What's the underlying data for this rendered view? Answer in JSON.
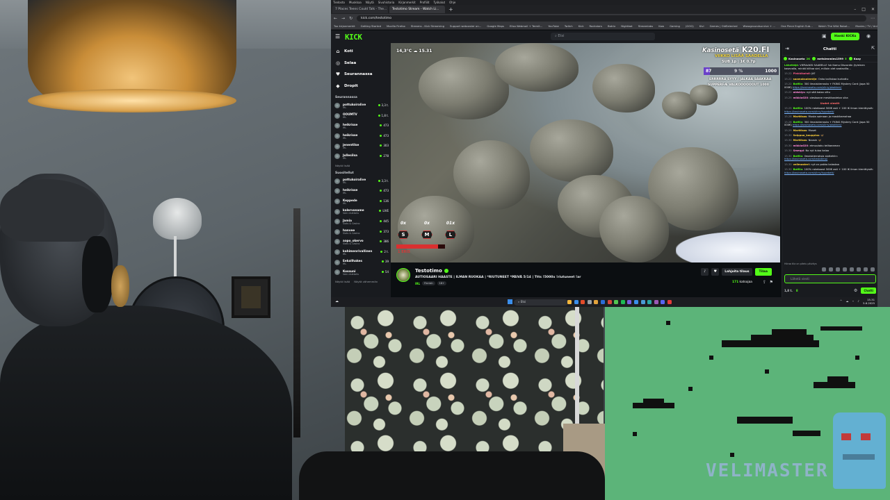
{
  "browser": {
    "menu_items": [
      "Tiedosto",
      "Muokkaa",
      "Näytä",
      "Sivuhistoria",
      "Kirjanmerkit",
      "Profiilit",
      "Työkalut",
      "Ohje"
    ],
    "tabs": [
      "7 Places Teens Could Talk - The...",
      "Testotimo Stream - Watch Li..."
    ],
    "url": "kick.com/testotimo",
    "bookmarks": [
      "Tuo kirjanmerkit",
      "Getting Started",
      "Mozilla Firefox",
      "Streams - Kick Streaming",
      "Support webcaster on...",
      "Google Maps",
      "Elisa Webmail + Termit...",
      "YouTube",
      "Twitch",
      "Kick",
      "Rockstars",
      "Botrix",
      "Nightbot",
      "Streamlabs",
      "Kaw",
      "Gaming",
      "(GOG)",
      "Kivi",
      "Games | OldSelected",
      "Wwwgroundsurvive + ...",
      "One Piece English Sub...",
      "Watch The Wild Robot...",
      "Movies / TV / Anime...",
      "Muut kirjanmerkit"
    ]
  },
  "kick": {
    "logo": "KICK",
    "search_placeholder": "Etsi",
    "login_label": "Hanki KICKs",
    "nav": [
      {
        "icon": "home-icon",
        "label": "Koti"
      },
      {
        "icon": "browse-icon",
        "label": "Selaa"
      },
      {
        "icon": "following-icon",
        "label": "Seurannassa"
      },
      {
        "icon": "drops-icon",
        "label": "Dropit"
      }
    ],
    "following_title": "Seurannassa",
    "following": [
      {
        "name": "pottukoiralive",
        "category": "IRL",
        "viewers": "3,3 t."
      },
      {
        "name": "OOUMTV",
        "category": "IRL",
        "viewers": "1,8 t."
      },
      {
        "name": "heikrisse",
        "category": "IRL",
        "viewers": "473"
      },
      {
        "name": "heikrisse",
        "category": "IRL",
        "viewers": "473"
      },
      {
        "name": "jenentilse",
        "category": "IRL",
        "viewers": "303"
      },
      {
        "name": "Jullesilsa",
        "category": "IRL",
        "viewers": "278"
      }
    ],
    "show_all_1": "Näytä lisää",
    "recommended_title": "Suositellut",
    "recommended": [
      {
        "name": "pottukoiralive",
        "category": "IRL",
        "viewers": "3,3 t."
      },
      {
        "name": "heikrisse",
        "category": "IRL",
        "viewers": "473"
      },
      {
        "name": "Keppede",
        "category": "IRL",
        "viewers": "136"
      },
      {
        "name": "kalervoname",
        "category": "Vain chattailu",
        "viewers": "LIVE"
      },
      {
        "name": "Jamia",
        "category": "Slots & Casino",
        "viewers": "445"
      },
      {
        "name": "hanvee",
        "category": "Slots & Casino",
        "viewers": "373"
      },
      {
        "name": "aapo_okervo",
        "category": "Slots & Casino",
        "viewers": "386"
      },
      {
        "name": "kahimenrivallinen",
        "category": "IRL",
        "viewers": "2 t."
      },
      {
        "name": "Eekallhakes",
        "category": "IRL",
        "viewers": "39"
      },
      {
        "name": "Kossuni",
        "category": "Vain chattailu",
        "viewers": "54"
      }
    ],
    "show_more": "Näytä lisää",
    "show_less": "Näytä vähemmän"
  },
  "player": {
    "temp": "14,3°C",
    "time": "15.31",
    "brand": "Kasinosetä",
    "brand_domain": "K20.FI",
    "banner": "VIIKKO LISÄÄ SAADELLA",
    "sub_line": "SUB 1p | 1€ 0.7p",
    "progress_current": "87",
    "progress_pct": "9 %",
    "progress_goal": "1000",
    "progress_value": 0.087,
    "goal_line_1": "ERRRRRA SYYY / JALKAA SAAKKAA",
    "goal_line_2": "SUPPERFÆ VALKOOOOOOUT 1000",
    "sml": [
      {
        "pct": "0x",
        "key": "S"
      },
      {
        "pct": "0x",
        "key": "M"
      },
      {
        "pct": "01x",
        "key": "L"
      }
    ],
    "hp_label": "1 ERIS",
    "hp_value": 0.85
  },
  "stream": {
    "name": "Testotimo",
    "title": "AUTIOSAARI HAASTE | ILMAN RUOKAA | *RIUTUNEET *PÄIVÄ 5/14 | Ttts !5000x !riutuneet !ar",
    "category": "IRL",
    "tags": [
      "Finnish",
      "18+"
    ],
    "gift_label": "Lahjoita tilaus",
    "follow_label": "Tilaa",
    "viewers": "171",
    "viewers_label": "katsojaa",
    "uptime": "5:31:19"
  },
  "chat": {
    "title": "Chatti",
    "pins": [
      {
        "name": "Kasinoseta",
        "amount": "2K"
      },
      {
        "name": "metsienmies1599",
        "amount": "5"
      },
      {
        "name": "Kaay",
        "amount": ""
      }
    ],
    "messages": [
      {
        "t": "",
        "u": "Lähettäjä",
        "c": "#53fc18",
        "m": "VIERAAKSI SAABELLE !sk Kamu Discordin (tyleinen kasevalla, minkä kiiltoa siel, milloin olet saatavilla..."
      },
      {
        "t": "15.22",
        "u": "Pinkkikohdi",
        "c": "#ff5c8a",
        "m": "Jä?"
      },
      {
        "t": "15.22",
        "u": "saamaksalemtje",
        "c": "#ffd23b",
        "m": "Onko kalliskaa kurkattu"
      },
      {
        "t": "15.22",
        "u": "BotRix",
        "c": "#53fc18",
        "m": "300 ilmaiskierrosta + FKING Mystery Card (jopa 50 000€)",
        "link": "https://kasinoseta.com/slirry/pkokkeri/"
      },
      {
        "t": "15.22",
        "u": "oldskiys",
        "c": "#ff8ad8",
        "m": "nyt sitä kalaa viltu"
      },
      {
        "t": "15.25",
        "u": "mikkio020",
        "c": "#ff8ad8",
        "m": "oleskoane meskikaaleton sika"
      },
      {
        "t": "",
        "u": "",
        "c": "",
        "m": "Uudet viestit",
        "divider": true
      },
      {
        "t": "15.25",
        "u": "BotRix",
        "c": "#53fc18",
        "m": "100% rakeboost 500€ asti + 100 IK ilman kierrätystä:",
        "link": "https://kasinoseta.com/slirry/hypebett/"
      },
      {
        "t": "15.28",
        "u": "Marttisas",
        "c": "#ffd23b",
        "m": "Musta soimaan ja maskikamahaa"
      },
      {
        "t": "15.28",
        "u": "BotRix",
        "c": "#53fc18",
        "m": "300 ilmaiskierrosta + FKING Mystery Card (jopa 50 000€)",
        "link": "https://kasinoseta.com/slirry/pkokkeri/"
      },
      {
        "t": "15.29",
        "u": "Marttisas",
        "c": "#ffd23b",
        "m": "Muset"
      },
      {
        "t": "15.30",
        "u": "Salppua_kauppias",
        "c": "#ffd23b",
        "m": "🦋"
      },
      {
        "t": "15.30",
        "u": "Marttisas",
        "c": "#ffd23b",
        "m": "Nousin 🦋"
      },
      {
        "t": "15.30",
        "u": "mikkio020",
        "c": "#ff8ad8",
        "m": "etmuutaku teiltaeaman"
      },
      {
        "t": "15.30",
        "u": "Smeqpi",
        "c": "#ff8ad8",
        "m": "No nyt tuloo kaloo"
      },
      {
        "t": "15.30",
        "u": "BotRix",
        "c": "#53fc18",
        "m": "Ilmaiskierroksia slottehiin:",
        "link": "https://kasinoseta.com/testotimo/"
      },
      {
        "t": "15.30",
        "u": "velimasteri",
        "c": "#ffd23b",
        "m": "nyt on pakko kalastaa"
      },
      {
        "t": "15.30",
        "u": "BotRix",
        "c": "#53fc18",
        "m": "100% rakeboost 500€ asti + 100 IK ilman kierrätystä:",
        "link": "https://kasinoseta.com/slirry/hypebett/"
      }
    ],
    "reply_hint": "Hiiraa tila on pitelu päivitys",
    "input_placeholder": "Lähetä viesti",
    "footer_stat_1": "1,8 t.",
    "footer_stat_2": "8",
    "send_label": "Chatti"
  },
  "taskbar": {
    "weather": "14°C",
    "search_placeholder": "Etsi",
    "time": "15.31",
    "date": "5.6.2025"
  },
  "overlay": {
    "velimaster": "VELIMASTER"
  },
  "colors": {
    "kick_green": "#53fc18",
    "kick_bg": "#0b0e11",
    "panel": "#191b1f",
    "game_green": "#5cb479"
  }
}
